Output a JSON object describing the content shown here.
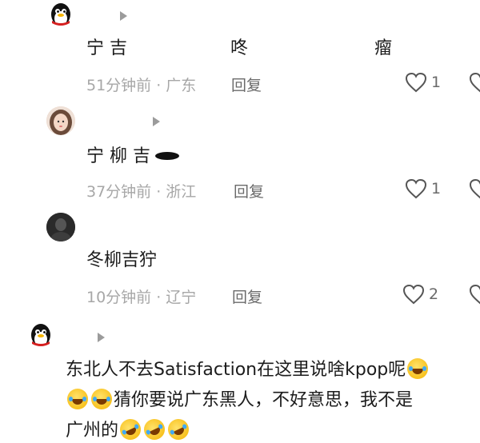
{
  "comments": [
    {
      "text_parts": [
        "宁 吉",
        "咚",
        "瘤"
      ],
      "time": "51分钟前 · 广东",
      "reply_label": "回复",
      "likes": "1"
    },
    {
      "text": "宁 柳 吉",
      "time": "37分钟前 · 浙江",
      "reply_label": "回复",
      "likes": "1"
    },
    {
      "text": "冬柳吉狞",
      "time": "10分钟前 · 辽宁",
      "reply_label": "回复",
      "likes": "2"
    },
    {
      "line1": "东北人不去Satisfaction在这里说啥kpop呢",
      "line2": "猜你要说广东黑人，不好意思，我不是",
      "line3": "广州的"
    }
  ],
  "icons": {
    "avatar_1": "qq-penguin-avatar",
    "avatar_2": "girl-photo-avatar",
    "avatar_3": "dark-photo-avatar",
    "avatar_4": "qq-penguin-avatar",
    "like": "heart-outline-icon",
    "emoji_laugh": "tears-of-joy-emoji",
    "emoji_rofl": "rolling-on-floor-laughing-emoji"
  },
  "colors": {
    "text": "#1c1c1c",
    "meta": "#a7a7a7",
    "reply": "#6a6a6a"
  }
}
